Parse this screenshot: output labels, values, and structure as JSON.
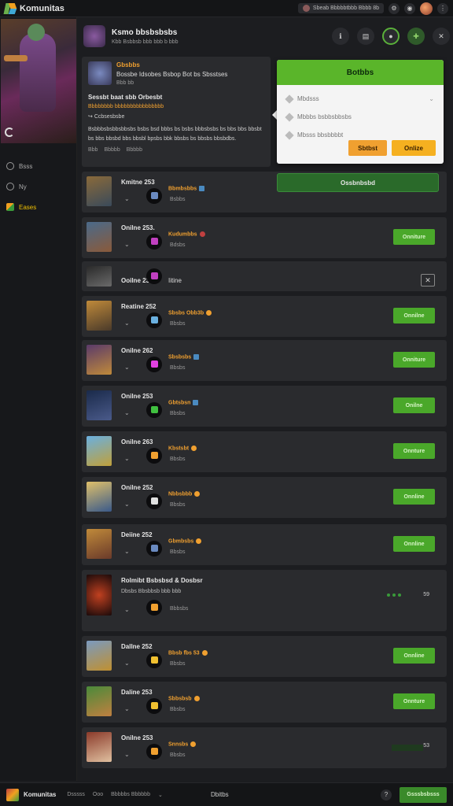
{
  "app": {
    "title": "Komunitas",
    "status_text": "Sbeab Bbbbbtbbb Bbbb 8b"
  },
  "sidebar": {
    "items": [
      {
        "label": "Bsss"
      },
      {
        "label": "Ny"
      },
      {
        "label": "Eases"
      }
    ]
  },
  "header": {
    "title": "Ksmo bbsbsbsbs",
    "subtitle": "Kbb Bsbbsb bbb bbb b bbb"
  },
  "notice": {
    "title": "Gbsbbs",
    "line1": "Bossbe Idsobes Bsbop Bot bs Sbsstses",
    "line2": "Bbb bb",
    "heading": "Sessbt baat sbb Orbesbt",
    "orange_line": "Bbbbbbbb bbbbbbbbbbbbbbbb",
    "bullet": "Ccbsesbsbe",
    "body": "Bsbbbsbsbbsbbsbs bsbs bsd bbbs bs bsbs bbbsbsbs bs bbs bbs bbsbt bs bbs bbsbd bbs bbsbl bpsbs bbk bbsbs bs bbsbs bbsbdbs.",
    "foot1": "Bbb",
    "foot2": "Bbbbb",
    "foot3": "Bbbbb"
  },
  "popup": {
    "title": "Botbbs",
    "rows": [
      {
        "label": "Mbdsss"
      },
      {
        "label": "Mbbbs bsbbsbbsbs"
      },
      {
        "label": "Mbsss bbsbbbbt"
      }
    ],
    "cancel": "Sbtbst",
    "confirm": "Onlize"
  },
  "green_bar_label": "Ossbnbsbd",
  "list": {
    "rows": [
      {
        "name": "Kmitne 253",
        "label": "Bbmbsbbs",
        "sub": "Bsbbs",
        "action": "",
        "badge": "blue"
      },
      {
        "name": "Onilne 253.",
        "label": "Kudumbbs",
        "sub": "Bdsbs",
        "action": "Onniture",
        "badge": "red"
      },
      {
        "name": "Ooilne 23",
        "plain": "Iitine",
        "action": "x"
      },
      {
        "name": "Reatine 252",
        "label": "Sbsbs Obb3b",
        "sub": "Bbsbs",
        "action": "Onnilne",
        "badge": "orange"
      },
      {
        "name": "Onilne 262",
        "label": "Sbsbsbs",
        "sub": "Bbsbs",
        "action": "Onniture",
        "badge": "blue"
      },
      {
        "name": "Onilne 253",
        "label": "Gbtsbsn",
        "sub": "Bbsbs",
        "action": "Onilne",
        "badge": "blue"
      },
      {
        "name": "Onilne 263",
        "label": "Kbstsbt",
        "sub": "Bbsbs",
        "action": "Onnture",
        "badge": "orange"
      },
      {
        "name": "Onilne 252",
        "label": "Nbbsbbb",
        "sub": "Bbsbs",
        "action": "Onnline",
        "badge": "orange"
      },
      {
        "name": "Deiine 252",
        "label": "Gbmbsbs",
        "sub": "Bbsbs",
        "action": "Onnline",
        "badge": "orange"
      },
      {
        "name": "Rolmibt Bsbsbsd & Dosbsr",
        "label": "",
        "sub": "Dbsbs Bbsbbsb bbb bbb",
        "sub2": "Bbbsbs",
        "num": "59"
      },
      {
        "name": "Dallne 252",
        "label": "Bbsb fbs 53",
        "sub": "Bbsbs",
        "action": "Onnline",
        "badge": "orange"
      },
      {
        "name": "Daline 253",
        "label": "Sbbsbsb",
        "sub": "Bbsbs",
        "action": "Onnture",
        "badge": "orange"
      },
      {
        "name": "Onilne 253",
        "label": "Snnsbs",
        "sub": "Bbsbs",
        "num": "53",
        "badge": "orange"
      }
    ]
  },
  "bottom": {
    "name": "Komunitas",
    "link1": "Dsssss",
    "link2": "Ooo",
    "link3": "Bbbbbs Bbbbbb",
    "mid": "Dbitbs",
    "btn": "Gsssbsbsss"
  }
}
